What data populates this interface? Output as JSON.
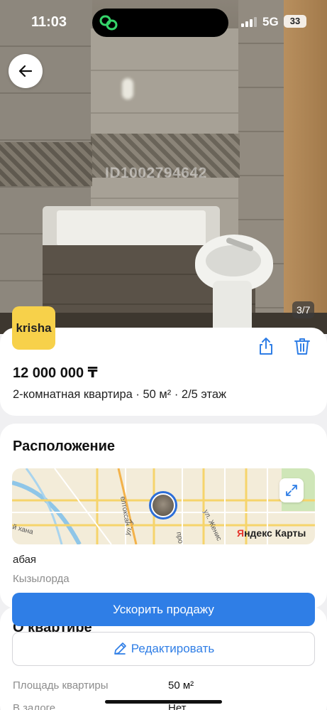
{
  "status_bar": {
    "time": "11:03",
    "network": "5G",
    "battery": "33"
  },
  "photo": {
    "watermark": "ID1002794642",
    "counter": "3/7"
  },
  "brand": {
    "logo_text": "krisha"
  },
  "listing": {
    "price": "12 000 000 ₸",
    "subtitle": "2-комнатная квартира · 50 м² · 2/5 этаж"
  },
  "location": {
    "title": "Расположение",
    "map_brand_part1": "Я",
    "map_brand_part2": "ндекс Карты",
    "map_labels": [
      "елтоксан",
      "ул. Женис",
      "й хана",
      "ул. У",
      "про"
    ],
    "address": "абая",
    "city": "Кызылорда"
  },
  "actions": {
    "boost_label": "Ускорить продажу",
    "edit_label": "Редактировать"
  },
  "about": {
    "title": "О квартире",
    "rows": [
      {
        "label": "Площадь квартиры",
        "value": "50 м²"
      },
      {
        "label": "В залоге",
        "value": "Нет"
      }
    ]
  },
  "colors": {
    "accent": "#2f7ee6",
    "brand_yellow": "#f7d14a",
    "map_brand_red": "#e5332a"
  }
}
